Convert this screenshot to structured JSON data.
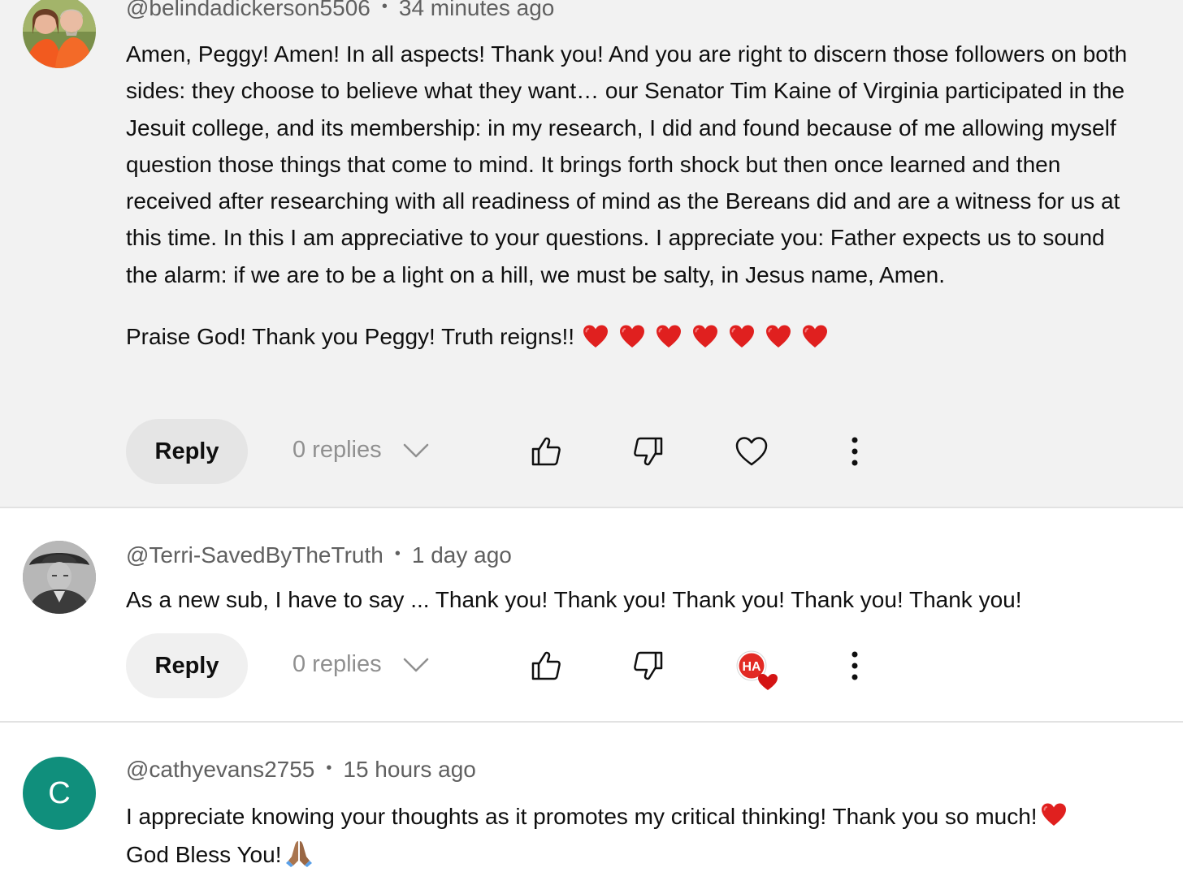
{
  "comments": [
    {
      "handle": "@belindadickerson5506",
      "time": "34 minutes ago",
      "paragraphs": [
        "Amen, Peggy! Amen! In all aspects! Thank you! And you are right to discern those followers on both sides: they choose to believe what they want… our Senator Tim Kaine of Virginia participated in the Jesuit college, and its membership: in my research, I did and found because of me allowing myself question those things that come to mind. It brings forth shock but then once learned and then received after researching with all readiness of mind as the Bereans did and are a witness for us at this time. In this I am appreciative to your questions. I appreciate you: Father expects us to sound the alarm: if we are to be a light on a hill, we must be salty, in Jesus name, Amen.",
        "Praise God! Thank you Peggy! Truth reigns!!"
      ],
      "reply_label": "Reply",
      "replies_label": "0 replies"
    },
    {
      "handle": "@Terri-SavedByTheTruth",
      "time": "1 day ago",
      "text": "As a new sub, I have to say ... Thank you! Thank you! Thank you! Thank you! Thank you!",
      "reply_label": "Reply",
      "replies_label": "0 replies",
      "creator_badge": "HA"
    },
    {
      "handle": "@cathyevans2755",
      "time": "15 hours ago",
      "avatar_letter": "C",
      "line1": "I appreciate knowing your thoughts as it promotes my critical thinking! Thank you so much!",
      "line2": "God Bless You!"
    }
  ],
  "separator": "•",
  "colors": {
    "selected_bg": "#f2f2f2",
    "avatar_c": "#108f7c",
    "heart_red": "#e0201f",
    "muted_text": "#606060"
  },
  "icons": [
    "thumbs-up-icon",
    "thumbs-down-icon",
    "heart-outline-icon",
    "more-vert-icon",
    "chevron-down-icon",
    "red-heart-emoji",
    "praying-hands-emoji"
  ]
}
